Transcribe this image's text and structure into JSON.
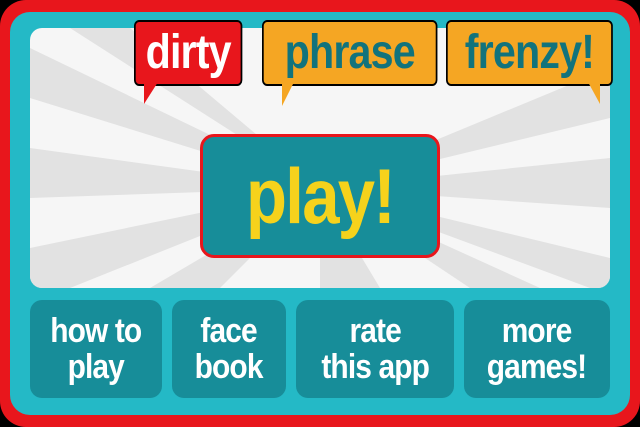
{
  "title": {
    "word1": "dirty",
    "word2": "phrase",
    "word3": "frenzy!"
  },
  "play_button": {
    "label": "play!"
  },
  "menu": [
    {
      "label": "how to\nplay"
    },
    {
      "label": "face\nbook"
    },
    {
      "label": "rate\nthis app"
    },
    {
      "label": "more\ngames!"
    }
  ],
  "colors": {
    "frame_red": "#e8161c",
    "frame_teal": "#24b9c6",
    "button_teal": "#178d99",
    "title_orange": "#f5a623",
    "play_yellow": "#f6d21c"
  }
}
